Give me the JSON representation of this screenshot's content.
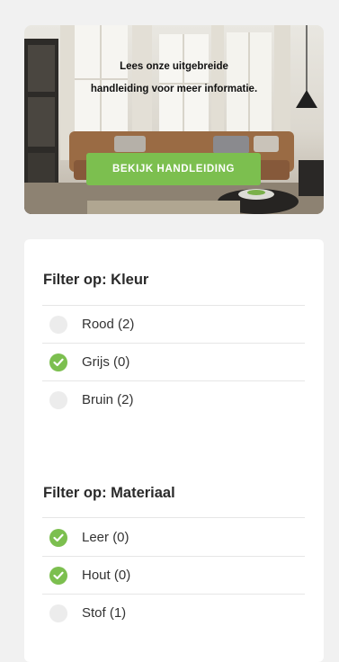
{
  "banner": {
    "line1": "Lees onze uitgebreide",
    "line2": "handleiding voor meer informatie.",
    "button_label": "BEKIJK HANDLEIDING"
  },
  "filters": {
    "kleur": {
      "title": "Filter op: Kleur",
      "options": [
        {
          "label": "Rood (2)",
          "checked": false
        },
        {
          "label": "Grijs (0)",
          "checked": true
        },
        {
          "label": "Bruin (2)",
          "checked": false
        }
      ]
    },
    "materiaal": {
      "title": "Filter op: Materiaal",
      "options": [
        {
          "label": "Leer (0)",
          "checked": true
        },
        {
          "label": "Hout (0)",
          "checked": true
        },
        {
          "label": "Stof (1)",
          "checked": false
        }
      ]
    }
  },
  "colors": {
    "accent": "#7cbf4f",
    "unchecked": "#ececec",
    "background": "#f1f1f1"
  },
  "icons": {
    "checked": "checkmark-icon"
  }
}
